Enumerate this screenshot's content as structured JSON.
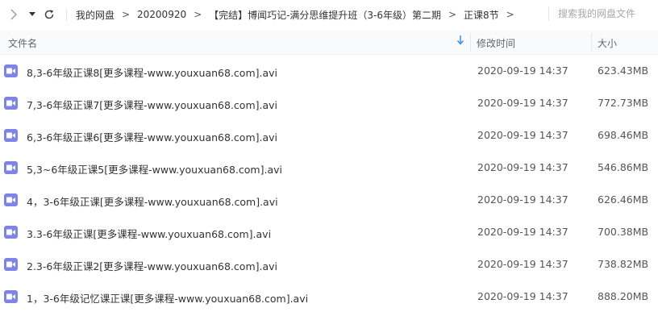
{
  "nav": {
    "forward_icon": "chevron-right-icon",
    "dropdown_icon": "caret-down-icon",
    "refresh_icon": "refresh-icon"
  },
  "breadcrumb": [
    "我的网盘",
    "20200920",
    "【完结】博闻巧记-满分思维提升班（3-6年级）第二期",
    "正课8节"
  ],
  "breadcrumb_separator": ">",
  "search": {
    "placeholder": "搜索我的网盘文件"
  },
  "columns": {
    "name": "文件名",
    "mtime": "修改时间",
    "size": "大小",
    "sort_icon": "sort-down-arrow-icon"
  },
  "colors": {
    "accent": "#3a8ee6",
    "video_icon": "#7e83e8"
  },
  "files": [
    {
      "name": "8,3-6年级正课8[更多课程-www.youxuan68.com].avi",
      "mtime": "2020-09-19 14:37",
      "size": "623.43MB"
    },
    {
      "name": "7,3-6年级正课7[更多课程-www.youxuan68.com].avi",
      "mtime": "2020-09-19 14:37",
      "size": "772.73MB"
    },
    {
      "name": "6,3-6年级正课6[更多课程-www.youxuan68.com].avi",
      "mtime": "2020-09-19 14:37",
      "size": "698.46MB"
    },
    {
      "name": "5,3~6年级正课5[更多课程-www.youxuan68.com].avi",
      "mtime": "2020-09-19 14:37",
      "size": "546.86MB"
    },
    {
      "name": "4，3-6年级正课[更多课程-www.youxuan68.com].avi",
      "mtime": "2020-09-19 14:37",
      "size": "626.46MB"
    },
    {
      "name": "3.3-6年级正课[更多课程-www.youxuan68.com].avi",
      "mtime": "2020-09-19 14:37",
      "size": "700.38MB"
    },
    {
      "name": "2.3-6年级正课2[更多课程-www.youxuan68.com].avi",
      "mtime": "2020-09-19 14:37",
      "size": "738.82MB"
    },
    {
      "name": "1，3-6年级记忆课正课[更多课程-www.youxuan68.com].avi",
      "mtime": "2020-09-19 14:37",
      "size": "888.20MB"
    }
  ]
}
